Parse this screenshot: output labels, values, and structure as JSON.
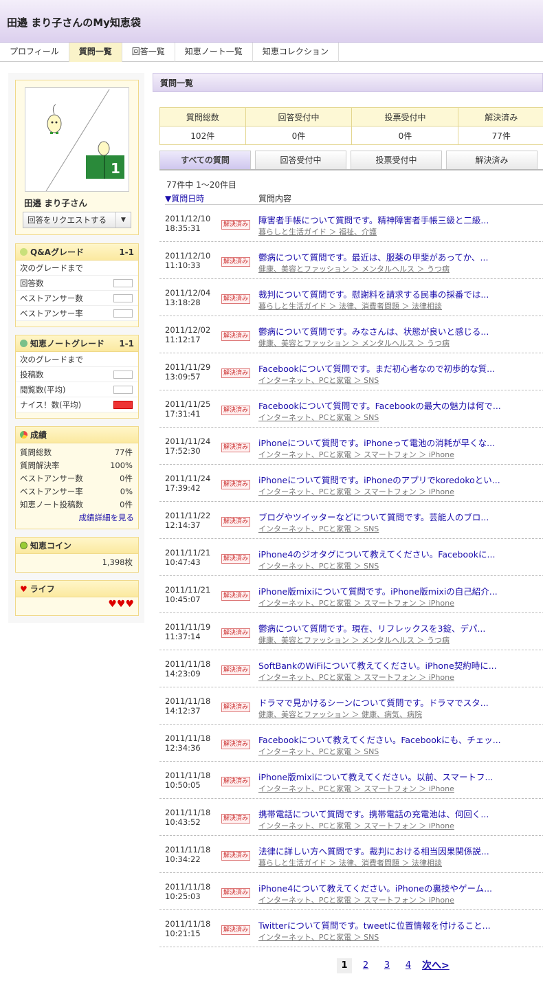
{
  "header": {
    "title": "田邉 まり子さんのMy知恵袋"
  },
  "tabs": [
    "プロフィール",
    "質問一覧",
    "回答一覧",
    "知恵ノート一覧",
    "知恵コレクション"
  ],
  "profile": {
    "name": "田邉 まり子さん",
    "request_button": "回答をリクエストする"
  },
  "qa_grade": {
    "title": "Q&Aグレード",
    "grade": "1-1",
    "rows": [
      "次のグレードまで",
      "回答数",
      "ベストアンサー数",
      "ベストアンサー率"
    ]
  },
  "note_grade": {
    "title": "知恵ノートグレード",
    "grade": "1-1",
    "rows": [
      "次のグレードまで",
      "投稿数",
      "閲覧数(平均)",
      "ナイス！数(平均)"
    ]
  },
  "results": {
    "title": "成績",
    "rows": [
      {
        "label": "質問総数",
        "value": "77件"
      },
      {
        "label": "質問解決率",
        "value": "100%"
      },
      {
        "label": "ベストアンサー数",
        "value": "0件"
      },
      {
        "label": "ベストアンサー率",
        "value": "0%"
      },
      {
        "label": "知恵ノート投稿数",
        "value": "0件"
      }
    ],
    "detail_link": "成績詳細を見る"
  },
  "coin": {
    "title": "知恵コイン",
    "value": "1,398枚"
  },
  "life": {
    "title": "ライフ",
    "hearts": "♥♥♥"
  },
  "main": {
    "title": "質問一覧",
    "stats": {
      "headers": [
        "質問総数",
        "回答受付中",
        "投票受付中",
        "解決済み"
      ],
      "values": [
        "102件",
        "0件",
        "0件",
        "77件"
      ]
    },
    "filter_tabs": [
      "すべての質問",
      "回答受付中",
      "投票受付中",
      "解決済み"
    ],
    "count_text": "77件中 1〜20件目",
    "col_date": "▼質問日時",
    "col_content": "質問内容",
    "badge": "解決済み",
    "items": [
      {
        "date": "2011/12/10",
        "time": "18:35:31",
        "title": "障害者手帳について質問です。精神障害者手帳三級と二級...",
        "cat": "暮らしと生活ガイド ＞ 福祉、介護"
      },
      {
        "date": "2011/12/10",
        "time": "11:10:33",
        "title": "鬱病について質問です。最近は、服薬の甲斐があってか、...",
        "cat": "健康、美容とファッション ＞ メンタルヘルス ＞ うつ病"
      },
      {
        "date": "2011/12/04",
        "time": "13:18:28",
        "title": "裁判について質問です。慰謝料を請求する民事の採番では...",
        "cat": "暮らしと生活ガイド ＞ 法律、消費者問題 ＞ 法律相談"
      },
      {
        "date": "2011/12/02",
        "time": "11:12:17",
        "title": "鬱病について質問です。みなさんは、状態が良いと感じる...",
        "cat": "健康、美容とファッション ＞ メンタルヘルス ＞ うつ病"
      },
      {
        "date": "2011/11/29",
        "time": "13:09:57",
        "title": "Facebookについて質問です。まだ初心者なので初歩的な質...",
        "cat": "インターネット、PCと家電 ＞ SNS"
      },
      {
        "date": "2011/11/25",
        "time": "17:31:41",
        "title": "Facebookについて質問です。Facebookの最大の魅力は何で...",
        "cat": "インターネット、PCと家電 ＞ SNS"
      },
      {
        "date": "2011/11/24",
        "time": "17:52:30",
        "title": "iPhoneについて質問です。iPhoneって電池の消耗が早くな...",
        "cat": "インターネット、PCと家電 ＞ スマートフォン ＞ iPhone"
      },
      {
        "date": "2011/11/24",
        "time": "17:39:42",
        "title": "iPhoneについて質問です。iPhoneのアプリでkoredokoとい...",
        "cat": "インターネット、PCと家電 ＞ スマートフォン ＞ iPhone"
      },
      {
        "date": "2011/11/22",
        "time": "12:14:37",
        "title": "ブログやツイッターなどについて質問です。芸能人のブロ...",
        "cat": "インターネット、PCと家電 ＞ SNS"
      },
      {
        "date": "2011/11/21",
        "time": "10:47:43",
        "title": "iPhone4のジオタグについて教えてください。Facebookに...",
        "cat": "インターネット、PCと家電 ＞ SNS"
      },
      {
        "date": "2011/11/21",
        "time": "10:45:07",
        "title": "iPhone版mixiについて質問です。iPhone版mixiの自己紹介...",
        "cat": "インターネット、PCと家電 ＞ スマートフォン ＞ iPhone"
      },
      {
        "date": "2011/11/19",
        "time": "11:37:14",
        "title": "鬱病について質問です。現在、リフレックスを3錠、デパ...",
        "cat": "健康、美容とファッション ＞ メンタルヘルス ＞ うつ病"
      },
      {
        "date": "2011/11/18",
        "time": "14:23:09",
        "title": "SoftBankのWiFiについて教えてください。iPhone契約時に...",
        "cat": "インターネット、PCと家電 ＞ スマートフォン ＞ iPhone"
      },
      {
        "date": "2011/11/18",
        "time": "14:12:37",
        "title": "ドラマで見かけるシーンについて質問です。ドラマでスタ...",
        "cat": "健康、美容とファッション ＞ 健康、病気、病院"
      },
      {
        "date": "2011/11/18",
        "time": "12:34:36",
        "title": "Facebookについて教えてください。Facebookにも、チェッ...",
        "cat": "インターネット、PCと家電 ＞ SNS"
      },
      {
        "date": "2011/11/18",
        "time": "10:50:05",
        "title": "iPhone版mixiについて教えてください。以前、スマートフ...",
        "cat": "インターネット、PCと家電 ＞ スマートフォン ＞ iPhone"
      },
      {
        "date": "2011/11/18",
        "time": "10:43:52",
        "title": "携帯電話について質問です。携帯電話の充電池は、何回く...",
        "cat": "インターネット、PCと家電 ＞ スマートフォン ＞ iPhone"
      },
      {
        "date": "2011/11/18",
        "time": "10:34:22",
        "title": "法律に詳しい方へ質問です。裁判における相当因果関係説...",
        "cat": "暮らしと生活ガイド ＞ 法律、消費者問題 ＞ 法律相談"
      },
      {
        "date": "2011/11/18",
        "time": "10:25:03",
        "title": "iPhone4について教えてください。iPhoneの裏技やゲーム...",
        "cat": "インターネット、PCと家電 ＞ スマートフォン ＞ iPhone"
      },
      {
        "date": "2011/11/18",
        "time": "10:21:15",
        "title": "Twitterについて質問です。tweetに位置情報を付けること...",
        "cat": "インターネット、PCと家電 ＞ SNS"
      }
    ],
    "pagination": {
      "pages": [
        "1",
        "2",
        "3",
        "4"
      ],
      "next": "次へ>"
    }
  },
  "colors": {
    "header": "#dcd0ee",
    "box_border": "#f0d98a",
    "badge": "#c33"
  }
}
